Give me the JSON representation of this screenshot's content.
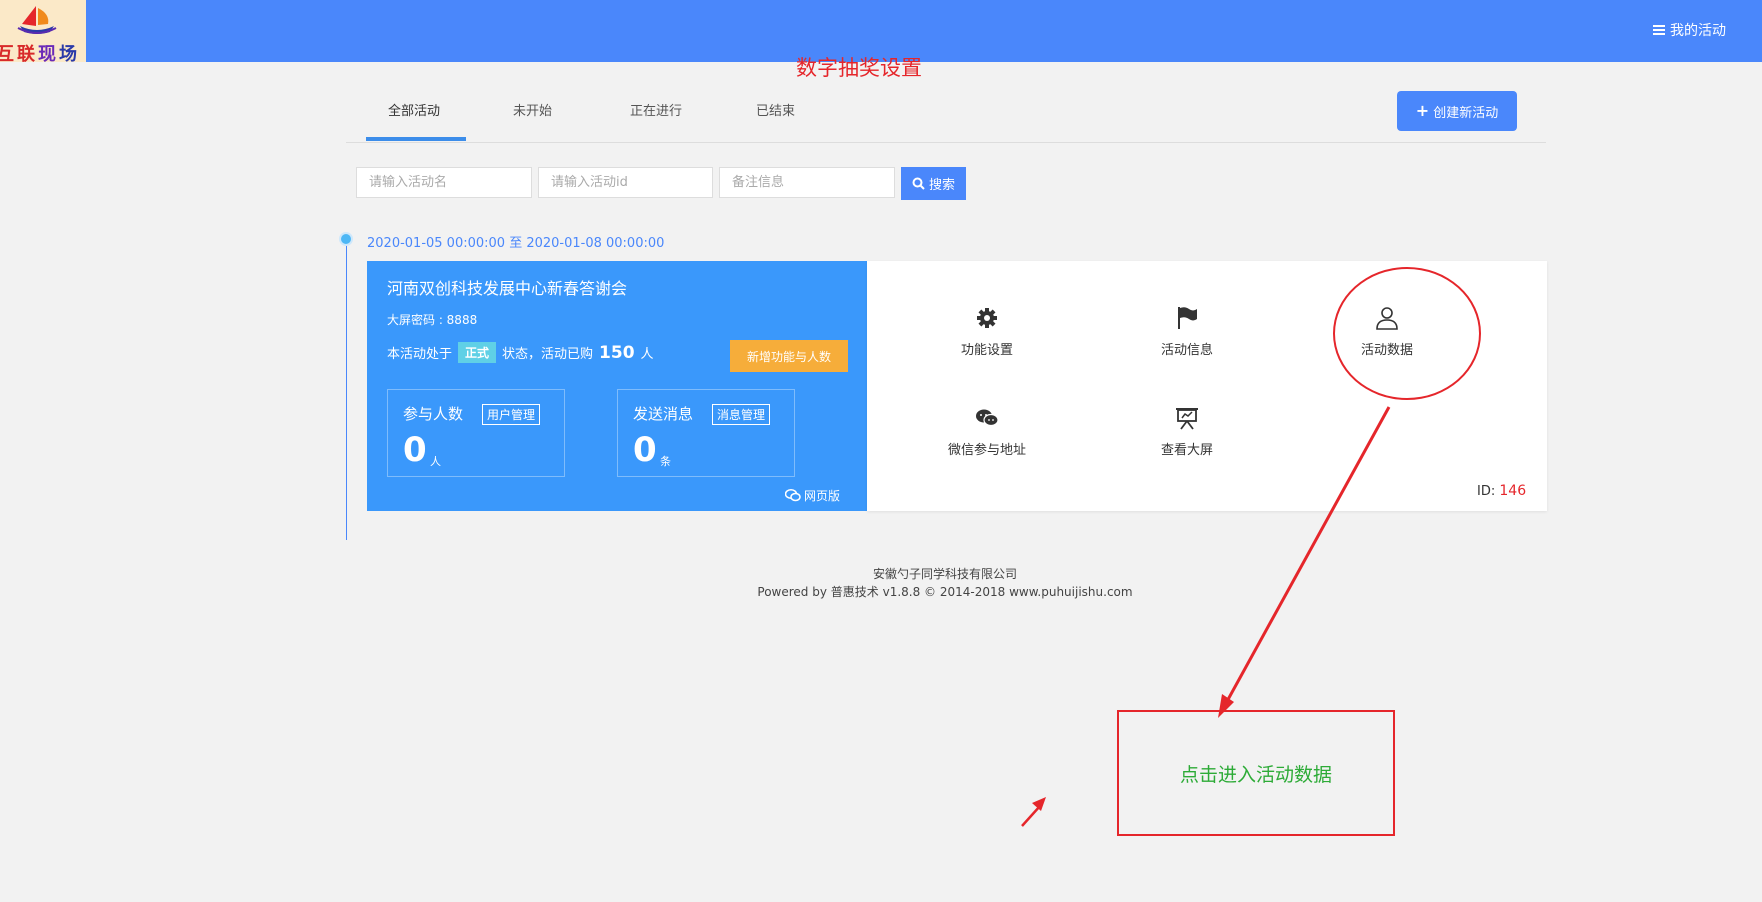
{
  "header": {
    "logo_text": "互联现场",
    "my_activities": "我的活动"
  },
  "page_title": "数字抽奖设置",
  "tabs": [
    {
      "label": "全部活动"
    },
    {
      "label": "未开始"
    },
    {
      "label": "正在进行"
    },
    {
      "label": "已结束"
    }
  ],
  "create_button": "创建新活动",
  "filters": {
    "name_placeholder": "请输入活动名",
    "id_placeholder": "请输入活动id",
    "note_placeholder": "备注信息",
    "search_label": "搜索"
  },
  "activity": {
    "date_range": "2020-01-05 00:00:00 至 2020-01-08 00:00:00",
    "title": "河南双创科技发展中心新春答谢会",
    "screen_password": "大屏密码 : 8888",
    "status_prefix": "本活动处于",
    "status_badge": "正式",
    "status_middle": "状态，活动已购",
    "purchased_count": "150",
    "purchased_unit": "人",
    "upgrade_button": "新增功能与人数",
    "participants": {
      "label": "参与人数",
      "manage": "用户管理",
      "value": "0",
      "unit": "人"
    },
    "messages": {
      "label": "发送消息",
      "manage": "消息管理",
      "value": "0",
      "unit": "条"
    },
    "web_version": "网页版",
    "functions": [
      {
        "label": "功能设置",
        "icon": "gear-icon"
      },
      {
        "label": "活动信息",
        "icon": "flag-icon"
      },
      {
        "label": "活动数据",
        "icon": "user-icon"
      },
      {
        "label": "微信参与地址",
        "icon": "wechat-icon"
      },
      {
        "label": "查看大屏",
        "icon": "presentation-icon"
      }
    ],
    "id_label": "ID:",
    "id_value": "146"
  },
  "footer": {
    "company": "安徽勺子同学科技有限公司",
    "powered": "Powered by 普惠技术 v1.8.8 © 2014-2018 www.puhuijishu.com"
  },
  "annotation": {
    "box_text": "点击进入活动数据"
  }
}
